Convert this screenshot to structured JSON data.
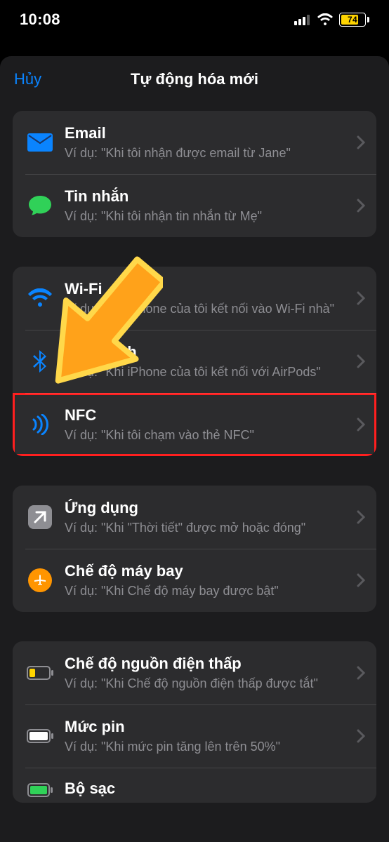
{
  "status": {
    "time": "10:08",
    "battery": "74"
  },
  "modal": {
    "cancel": "Hủy",
    "title": "Tự động hóa mới"
  },
  "groups": [
    {
      "rows": [
        {
          "id": "email",
          "title": "Email",
          "sub": "Ví dụ: \"Khi tôi nhận được email từ Jane\""
        },
        {
          "id": "message",
          "title": "Tin nhắn",
          "sub": "Ví dụ: \"Khi tôi nhận tin nhắn từ Mẹ\""
        }
      ]
    },
    {
      "rows": [
        {
          "id": "wifi",
          "title": "Wi-Fi",
          "sub": "Ví dụ: \"Khi iPhone của tôi kết nối vào Wi-Fi nhà\""
        },
        {
          "id": "bluetooth",
          "title": "Bluetooth",
          "sub": "Ví dụ: \"Khi iPhone của tôi kết nối với AirPods\""
        },
        {
          "id": "nfc",
          "title": "NFC",
          "sub": "Ví dụ: \"Khi tôi chạm vào thẻ NFC\""
        }
      ]
    },
    {
      "rows": [
        {
          "id": "app-open",
          "title": "Ứng dụng",
          "sub": "Ví dụ: \"Khi \"Thời tiết\" được mở hoặc đóng\""
        },
        {
          "id": "airplane",
          "title": "Chế độ máy bay",
          "sub": "Ví dụ: \"Khi Chế độ máy bay được bật\""
        }
      ]
    },
    {
      "rows": [
        {
          "id": "low-power",
          "title": "Chế độ nguồn điện thấp",
          "sub": "Ví dụ: \"Khi Chế độ nguồn điện thấp được tắt\""
        },
        {
          "id": "battery",
          "title": "Mức pin",
          "sub": "Ví dụ: \"Khi mức pin tăng lên trên 50%\""
        },
        {
          "id": "charger",
          "title": "Bộ sạc",
          "sub": ""
        }
      ]
    }
  ]
}
